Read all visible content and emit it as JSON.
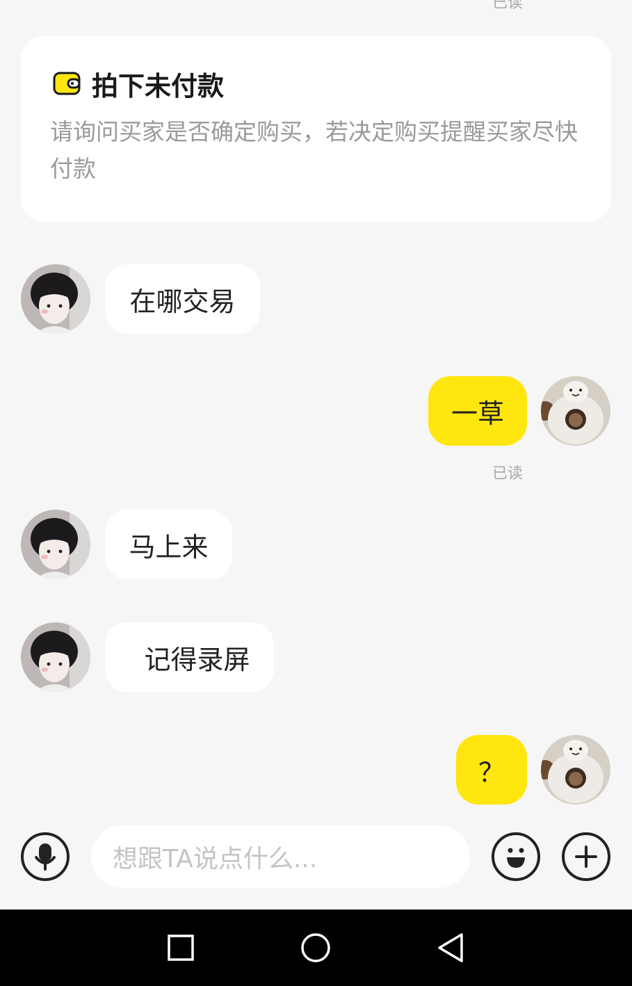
{
  "chat": {
    "top_read_status": "已读",
    "order_card": {
      "title": "拍下未付款",
      "description": "请询问买家是否确定购买，若决定购买提醒买家尽快付款",
      "icon": "wallet-icon",
      "icon_color": "#ffe60f"
    },
    "messages": [
      {
        "sender": "other",
        "text": "在哪交易"
      },
      {
        "sender": "self",
        "text": "一草",
        "status": "已读"
      },
      {
        "sender": "other",
        "text": "马上来"
      },
      {
        "sender": "other",
        "text": "记得录屏"
      },
      {
        "sender": "self",
        "text": "？"
      }
    ]
  },
  "input_bar": {
    "voice_icon": "microphone-icon",
    "placeholder": "想跟TA说点什么...",
    "emoji_icon": "smiley-icon",
    "more_icon": "plus-icon"
  },
  "navigation_bar": {
    "buttons": [
      "recents-square-icon",
      "home-circle-icon",
      "back-triangle-icon"
    ]
  },
  "colors": {
    "accent": "#ffe60f",
    "background": "#f6f6f6",
    "bubble_incoming": "#ffffff",
    "text_primary": "#222222",
    "text_secondary": "#9a9a9a"
  }
}
